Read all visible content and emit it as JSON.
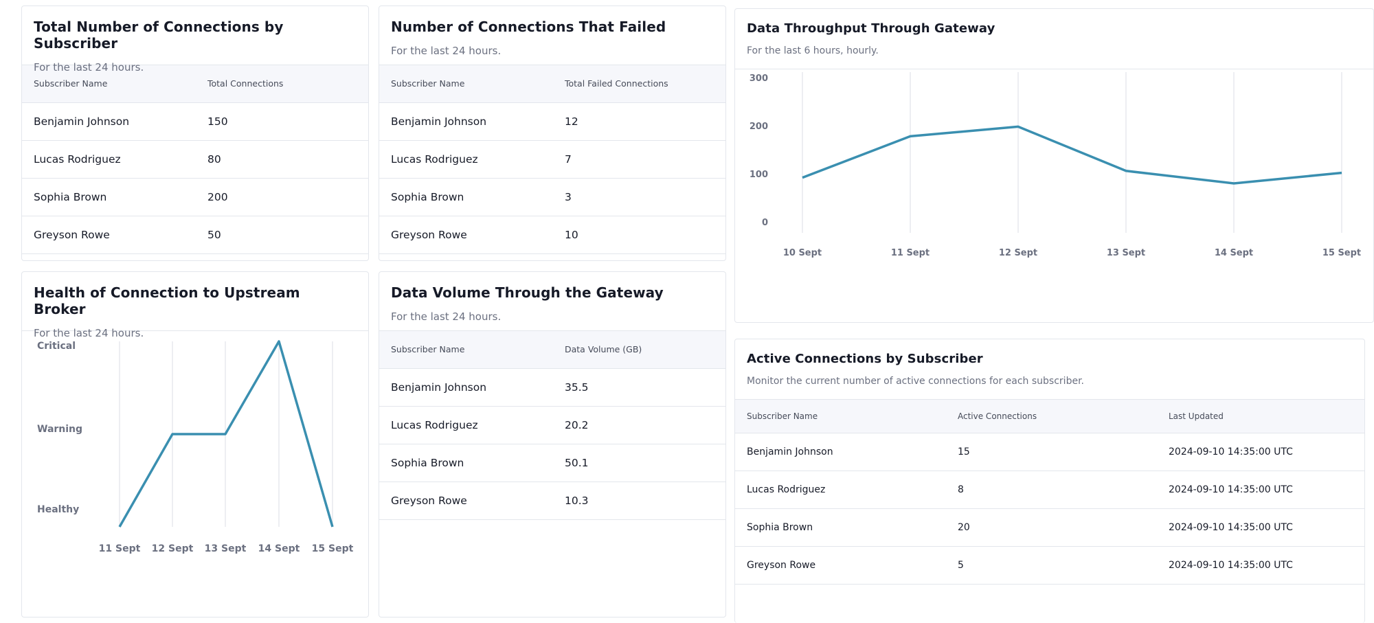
{
  "colors": {
    "line": "#3a8fb0",
    "header_bg": "#f6f7fb",
    "border": "#e3e6ec"
  },
  "total_connections": {
    "title": "Total Number of Connections by Subscriber",
    "subtitle": "For the last 24 hours.",
    "headers": [
      "Subscriber Name",
      "Total Connections"
    ],
    "rows": [
      [
        "Benjamin Johnson",
        "150"
      ],
      [
        "Lucas Rodriguez",
        "80"
      ],
      [
        "Sophia Brown",
        "200"
      ],
      [
        "Greyson Rowe",
        "50"
      ]
    ]
  },
  "failed_connections": {
    "title": "Number of Connections That Failed",
    "subtitle": "For the last 24 hours.",
    "headers": [
      "Subscriber Name",
      "Total Failed Connections"
    ],
    "rows": [
      [
        "Benjamin Johnson",
        "12"
      ],
      [
        "Lucas Rodriguez",
        "7"
      ],
      [
        "Sophia Brown",
        "3"
      ],
      [
        "Greyson Rowe",
        "10"
      ]
    ]
  },
  "health": {
    "title": "Health of Connection to Upstream Broker",
    "subtitle": "For the last 24 hours."
  },
  "data_volume": {
    "title": "Data Volume Through the Gateway",
    "subtitle": "For the last 24 hours.",
    "headers": [
      "Subscriber Name",
      "Data Volume (GB)"
    ],
    "rows": [
      [
        "Benjamin Johnson",
        "35.5"
      ],
      [
        "Lucas Rodriguez",
        "20.2"
      ],
      [
        "Sophia Brown",
        "50.1"
      ],
      [
        "Greyson Rowe",
        "10.3"
      ]
    ]
  },
  "throughput": {
    "title": "Data Throughput Through Gateway",
    "subtitle": "For the last 6 hours, hourly."
  },
  "active_connections": {
    "title": "Active Connections by Subscriber",
    "subtitle": "Monitor the current number of active connections for each subscriber.",
    "headers": [
      "Subscriber Name",
      "Active Connections",
      "Last Updated"
    ],
    "rows": [
      [
        "Benjamin Johnson",
        "15",
        "2024-09-10 14:35:00 UTC"
      ],
      [
        "Lucas Rodriguez",
        "8",
        "2024-09-10 14:35:00 UTC"
      ],
      [
        "Sophia Brown",
        "20",
        "2024-09-10 14:35:00 UTC"
      ],
      [
        "Greyson Rowe",
        "5",
        "2024-09-10 14:35:00 UTC"
      ]
    ]
  },
  "chart_data": [
    {
      "type": "line",
      "title": "Health of Connection to Upstream Broker",
      "categories": [
        "11 Sept",
        "12 Sept",
        "13 Sept",
        "14 Sept",
        "15 Sept"
      ],
      "y_levels": [
        "Healthy",
        "Warning",
        "Critical"
      ],
      "series": [
        {
          "values": [
            "Healthy",
            "Warning",
            "Warning",
            "Critical",
            "Healthy"
          ]
        }
      ],
      "grid": "vertical"
    },
    {
      "type": "line",
      "title": "Data Throughput Through Gateway",
      "categories": [
        "10 Sept",
        "11 Sept",
        "12 Sept",
        "13 Sept",
        "14 Sept",
        "15 Sept"
      ],
      "yticks": [
        "0",
        "100",
        "200",
        "300"
      ],
      "ylim": [
        0,
        300
      ],
      "series": [
        {
          "values": [
            92,
            178,
            198,
            106,
            80,
            102
          ]
        }
      ],
      "grid": "vertical"
    }
  ]
}
